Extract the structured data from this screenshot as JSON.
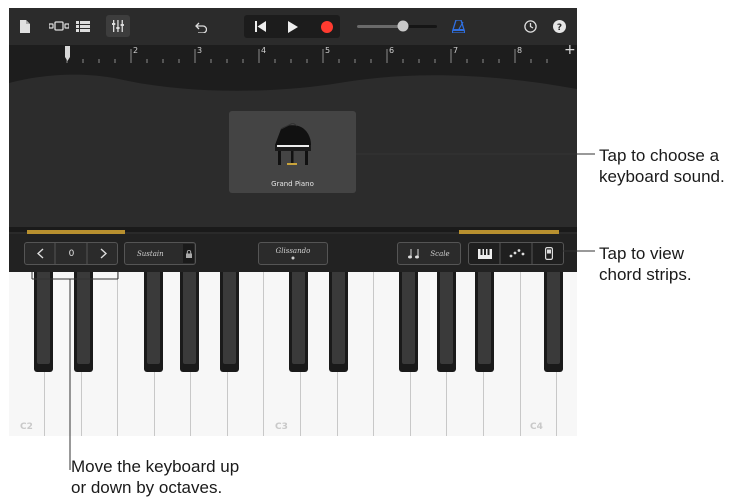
{
  "ruler": {
    "marks": [
      "2",
      "3",
      "4",
      "5",
      "6",
      "7",
      "8"
    ],
    "add": "+"
  },
  "instrument": {
    "name": "Grand Piano"
  },
  "controls": {
    "octave_value": "0",
    "sustain": "Sustain",
    "glissando": "Glissando",
    "scale": "Scale"
  },
  "keyboard": {
    "octave_labels": [
      "C2",
      "C3",
      "C4"
    ]
  },
  "callouts": {
    "sound": [
      "Tap to choose a",
      "keyboard sound."
    ],
    "chords": [
      "Tap to view",
      "chord strips."
    ],
    "octave": [
      "Move the keyboard up",
      "or down by octaves."
    ]
  },
  "colors": {
    "record": "#ff3b30",
    "metronome": "#2f6fe0",
    "amber": "#b8902f"
  },
  "icons": [
    "document-icon",
    "view-toggle-icon",
    "tracks-icon",
    "mixer-icon",
    "undo-icon",
    "rewind-icon",
    "play-icon",
    "record-icon",
    "volume-slider",
    "metronome-icon",
    "settings-icon",
    "help-icon",
    "lock-icon",
    "piano-keys-icon",
    "arpeggiator-icon",
    "chord-strip-icon"
  ]
}
